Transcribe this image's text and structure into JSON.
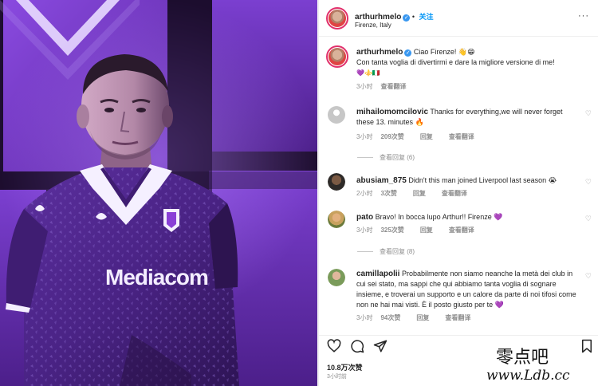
{
  "post": {
    "author": "arthurhmelo",
    "follow_label": "关注",
    "location": "Firenze, Italy",
    "more_label": "···",
    "caption_line1": "Ciao Firenze! 👋😁",
    "caption_line2": "Con tanta voglia di divertirmi e dare la migliore versione di me!",
    "caption_line3": "💜⚜️🇮🇹",
    "caption_time": "3小时",
    "translate_label": "查看翻译"
  },
  "comments": [
    {
      "user": "mihailomomcilovic",
      "text": "Thanks for everything,we will never forget these 13. minutes 🔥",
      "time": "3小时",
      "likes": "209次赞",
      "reply_label": "回复",
      "translate_label": "查看翻译",
      "view_replies": "查看回复 (6)"
    },
    {
      "user": "abusiam_875",
      "text": "Didn't this man joined Liverpool last season 😭",
      "time": "2小时",
      "likes": "3次赞",
      "reply_label": "回复",
      "translate_label": "查看翻译"
    },
    {
      "user": "pato",
      "text": "Bravo! In bocca lupo Arthur!! Firenze 💜",
      "time": "3小时",
      "likes": "325次赞",
      "reply_label": "回复",
      "translate_label": "查看翻译",
      "view_replies": "查看回复 (8)"
    },
    {
      "user": "camillapolii",
      "text": "Probabilmente non siamo neanche la metà dei club in cui sei stato, ma sappi che qui abbiamo tanta voglia di sognare insieme, e troverai un supporto e un calore da parte di noi tifosi come non ne hai mai visti. È il posto giusto per te 💜",
      "time": "3小时",
      "likes": "94次赞",
      "reply_label": "回复",
      "translate_label": "查看翻译"
    }
  ],
  "footer": {
    "likes": "10.8万次赞",
    "time": "3小时前"
  },
  "photo": {
    "sponsor_text": "Mediacom"
  },
  "watermark": {
    "line1": "零点吧",
    "line2": "www.Ldb.cc"
  },
  "colors": {
    "accent": "#0095f6",
    "verified": "#3897f0",
    "purple": "#6a2bb0"
  }
}
